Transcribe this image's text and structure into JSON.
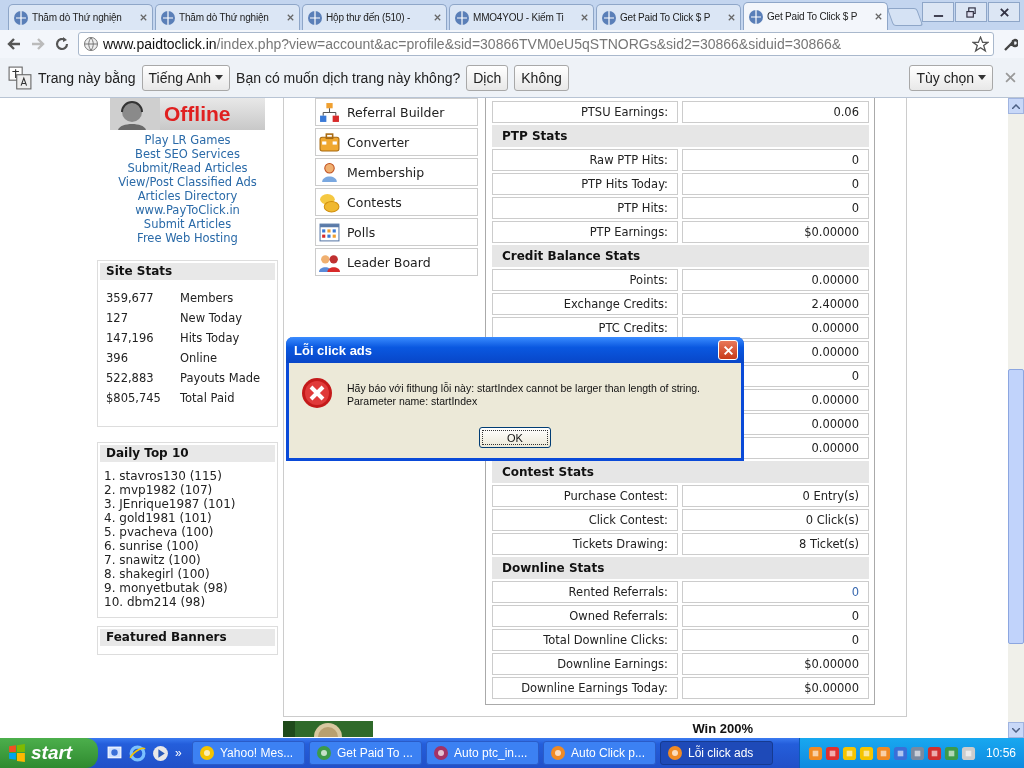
{
  "browser": {
    "tabs": [
      {
        "title": "Thăm dò Thứ nghiện",
        "selected": false
      },
      {
        "title": "Thăm dò Thứ nghiện",
        "selected": false
      },
      {
        "title": "Hộp thư đến (510) -",
        "selected": false
      },
      {
        "title": "MMO4YOU - Kiếm Ti",
        "selected": false
      },
      {
        "title": "Get Paid To Click $ P",
        "selected": false
      },
      {
        "title": "Get Paid To Click $ P",
        "selected": true
      }
    ],
    "address_bar": {
      "host": "www.paidtoclick.in",
      "path": "/index.php?view=account&ac=profile&sid=30866TVM0eU5qSTNORGs&sid2=30866&siduid=30866&"
    },
    "translate_bar": {
      "prefix": "Trang này bằng",
      "language": "Tiếng Anh",
      "question": "Bạn có muốn dịch trang này không?",
      "buttons": [
        "Dịch",
        "Không"
      ],
      "options": "Tùy chọn"
    }
  },
  "left_column": {
    "banner_text": "Offline",
    "links": [
      "Play LR Games",
      "Best SEO Services",
      "Submit/Read Articles",
      "View/Post Classified Ads",
      "Articles Directory",
      "www.PayToClick.in",
      "Submit Articles",
      "Free Web Hosting"
    ],
    "site_stats": {
      "title": "Site Stats",
      "rows": [
        {
          "value": "359,677",
          "label": "Members"
        },
        {
          "value": "127",
          "label": "New Today"
        },
        {
          "value": "147,196",
          "label": "Hits Today"
        },
        {
          "value": "396",
          "label": "Online"
        },
        {
          "value": "522,883",
          "label": "Payouts Made"
        },
        {
          "value": "$805,745",
          "label": "Total Paid"
        }
      ]
    },
    "daily_top": {
      "title": "Daily Top 10",
      "entries": [
        "1. stavros130 (115)",
        "2. mvp1982 (107)",
        "3. JEnrique1987 (101)",
        "4. gold1981 (101)",
        "5. pvacheva (100)",
        "6. sunrise (100)",
        "7. snawitz (100)",
        "8. shakegirl (100)",
        "9. monyetbutak (98)",
        "10. dbm214 (98)"
      ]
    },
    "featured_banners": {
      "title": "Featured Banners"
    }
  },
  "menu": [
    "Referral Builder",
    "Converter",
    "Membership",
    "Contests",
    "Polls",
    "Leader Board"
  ],
  "stats": [
    {
      "rows": [
        {
          "label": "PTSU Earnings:",
          "value": "0.06",
          "link": false
        }
      ]
    },
    {
      "title": "PTP Stats",
      "rows": [
        {
          "label": "Raw PTP Hits:",
          "value": "0",
          "link": false
        },
        {
          "label": "PTP Hits Today:",
          "value": "0",
          "link": false
        },
        {
          "label": "PTP Hits:",
          "value": "0",
          "link": false
        },
        {
          "label": "PTP Earnings:",
          "value": "$0.00000",
          "link": false
        }
      ]
    },
    {
      "title": "Credit Balance Stats",
      "rows": [
        {
          "label": "Points:",
          "value": "0.00000",
          "link": false
        },
        {
          "label": "Exchange Credits:",
          "value": "2.40000",
          "link": false
        },
        {
          "label": "PTC Credits:",
          "value": "0.00000",
          "link": false
        },
        {
          "value": "0.00000",
          "link": false
        },
        {
          "value": "0",
          "link": false
        },
        {
          "value": "0.00000",
          "link": false
        },
        {
          "value": "0.00000",
          "link": false
        },
        {
          "value": "0.00000",
          "link": false
        }
      ]
    },
    {
      "title": "Contest Stats",
      "rows": [
        {
          "label": "Purchase Contest:",
          "value": "0 Entry(s)",
          "link": false
        },
        {
          "label": "Click Contest:",
          "value": "0 Click(s)",
          "link": false
        },
        {
          "label": "Tickets Drawing:",
          "value": "8 Ticket(s)",
          "link": false
        }
      ]
    },
    {
      "title": "Downline Stats",
      "rows": [
        {
          "label": "Rented Referrals:",
          "value": "0",
          "link": true
        },
        {
          "label": "Owned Referrals:",
          "value": "0",
          "link": false
        },
        {
          "label": "Total Downline Clicks:",
          "value": "0",
          "link": false
        },
        {
          "label": "Downline Earnings:",
          "value": "$0.00000",
          "link": false
        },
        {
          "label": "Downline Earnings Today:",
          "value": "$0.00000",
          "link": false
        }
      ]
    }
  ],
  "ad_banner": {
    "text": "Win 200%"
  },
  "dialog": {
    "title": "Lỗi click ads",
    "message": "Hãy báo với fithung lỗi này: startIndex cannot be larger than length of string.\nParameter name: startIndex",
    "button": "OK"
  },
  "taskbar": {
    "start": "start",
    "overflow": "»",
    "tasks": [
      {
        "label": "Yahoo! Mes...",
        "selected": false
      },
      {
        "label": "Get Paid To ...",
        "selected": false
      },
      {
        "label": "Auto ptc_in....",
        "selected": false
      },
      {
        "label": "Auto Click p...",
        "selected": false
      },
      {
        "label": "Lỗi click ads",
        "selected": true
      }
    ],
    "clock": "10:56"
  }
}
